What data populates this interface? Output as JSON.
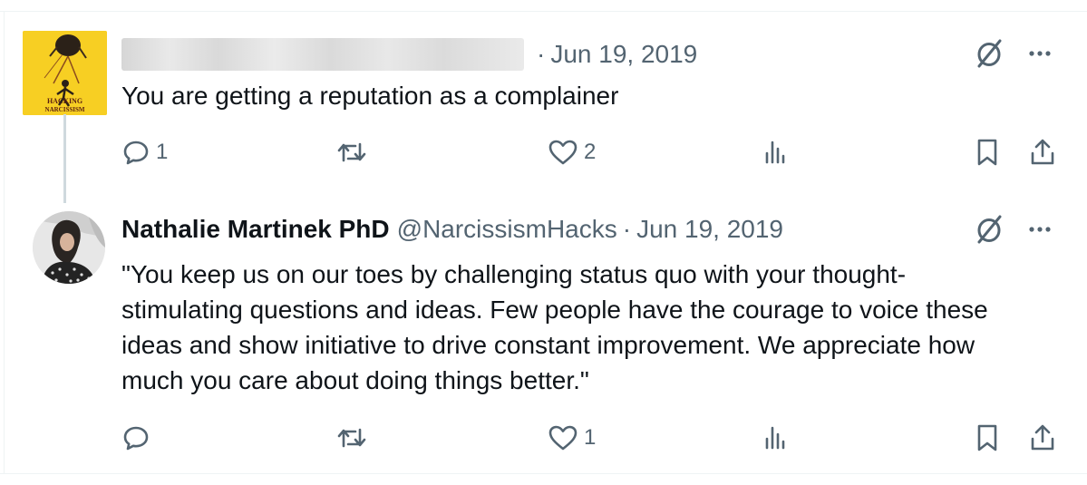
{
  "posts": [
    {
      "avatar_text": "HACKING NARCISSISM",
      "display_name": "",
      "handle": "",
      "separator": "·",
      "date": "Jun 19, 2019",
      "text": "You are getting a reputation as a complainer",
      "actions": {
        "replies": "1",
        "reposts": "",
        "likes": "2"
      },
      "name_blurred": true
    },
    {
      "display_name": "Nathalie Martinek PhD",
      "handle": "@NarcissismHacks",
      "separator": "·",
      "date": "Jun 19, 2019",
      "text": "\"You keep us on our toes by challenging status quo with your thought-stimulating questions and ideas. Few people have the courage to voice these ideas and show initiative to drive constant improvement. We appreciate how much you care about doing things better.\"",
      "actions": {
        "replies": "",
        "reposts": "",
        "likes": "1"
      }
    }
  ],
  "icons": [
    "grok-icon",
    "more-icon",
    "reply-icon",
    "repost-icon",
    "like-icon",
    "views-icon",
    "bookmark-icon",
    "share-icon"
  ],
  "colors": {
    "text": "#0f1419",
    "secondary": "#536471",
    "thread_line": "#cfd9de",
    "avatar_yellow": "#f7cf23"
  }
}
